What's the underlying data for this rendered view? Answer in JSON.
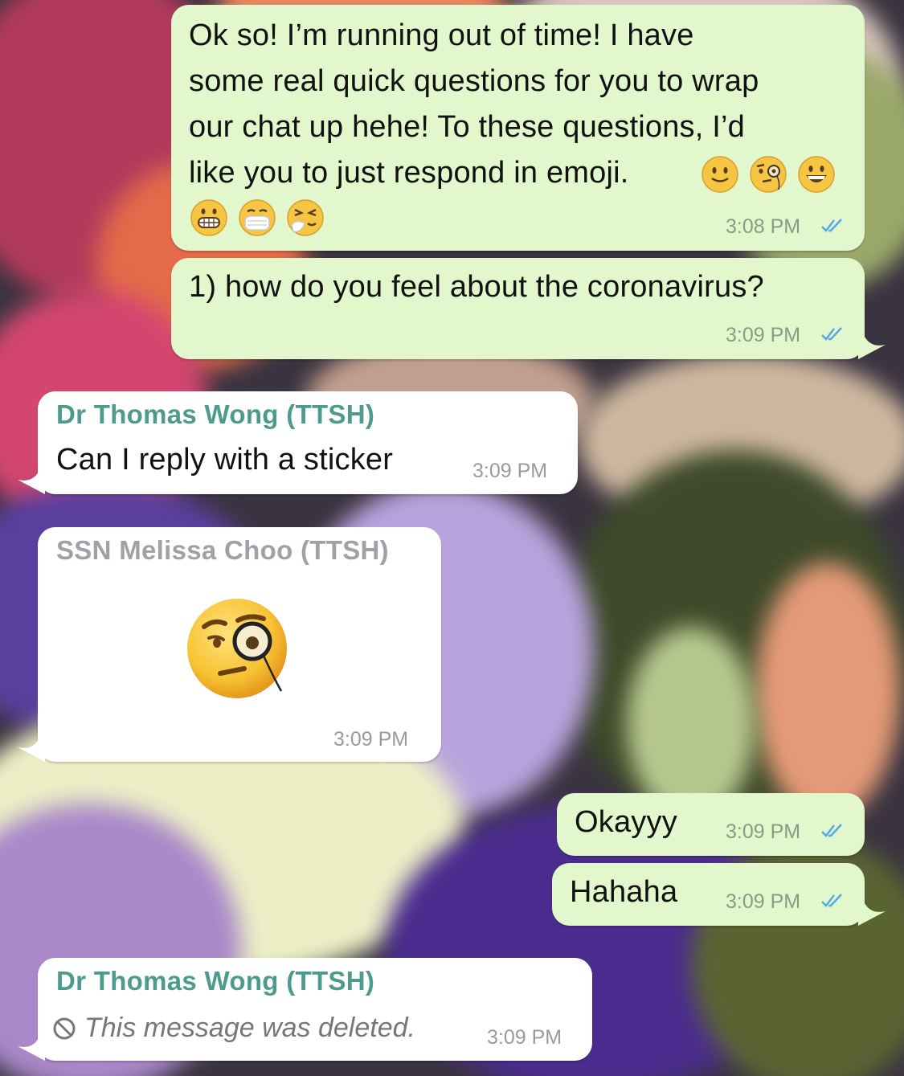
{
  "colors": {
    "outgoing_bubble": "#e2f8cc",
    "incoming_bubble": "#ffffff",
    "read_ticks": "#4fa9e8",
    "sender_thomas": "#4d9b8c",
    "sender_melissa": "#a49fa6"
  },
  "messages": {
    "m1": {
      "text_line1": "Ok so! I’m running out of time! I have",
      "text_line2": "some real quick questions for you to wrap",
      "text_line3": "our chat up hehe! To these questions, I’d",
      "text_line4": "like you to just respond in emoji.",
      "time": "3:08 PM",
      "emojis_line1": [
        "slightly-smiling-face",
        "face-with-monocle",
        "grinning-face-with-big-eyes"
      ],
      "emojis_line2": [
        "grimacing-face",
        "face-with-medical-mask",
        "sneezing-face"
      ]
    },
    "m2": {
      "text": "1) how do you feel about the coronavirus?",
      "time": "3:09 PM"
    },
    "m3": {
      "sender": "Dr Thomas Wong (TTSH)",
      "text": "Can I reply with a sticker",
      "time": "3:09 PM"
    },
    "m4": {
      "sender": "SSN Melissa Choo (TTSH)",
      "sticker": "face-with-monocle",
      "time": "3:09 PM"
    },
    "m5": {
      "text": "Okayyy",
      "time": "3:09 PM"
    },
    "m6": {
      "text": "Hahaha",
      "time": "3:09 PM"
    },
    "m7": {
      "sender": "Dr Thomas Wong (TTSH)",
      "text": "This message was deleted.",
      "time": "3:09 PM",
      "icon": "prohibited-icon"
    }
  }
}
